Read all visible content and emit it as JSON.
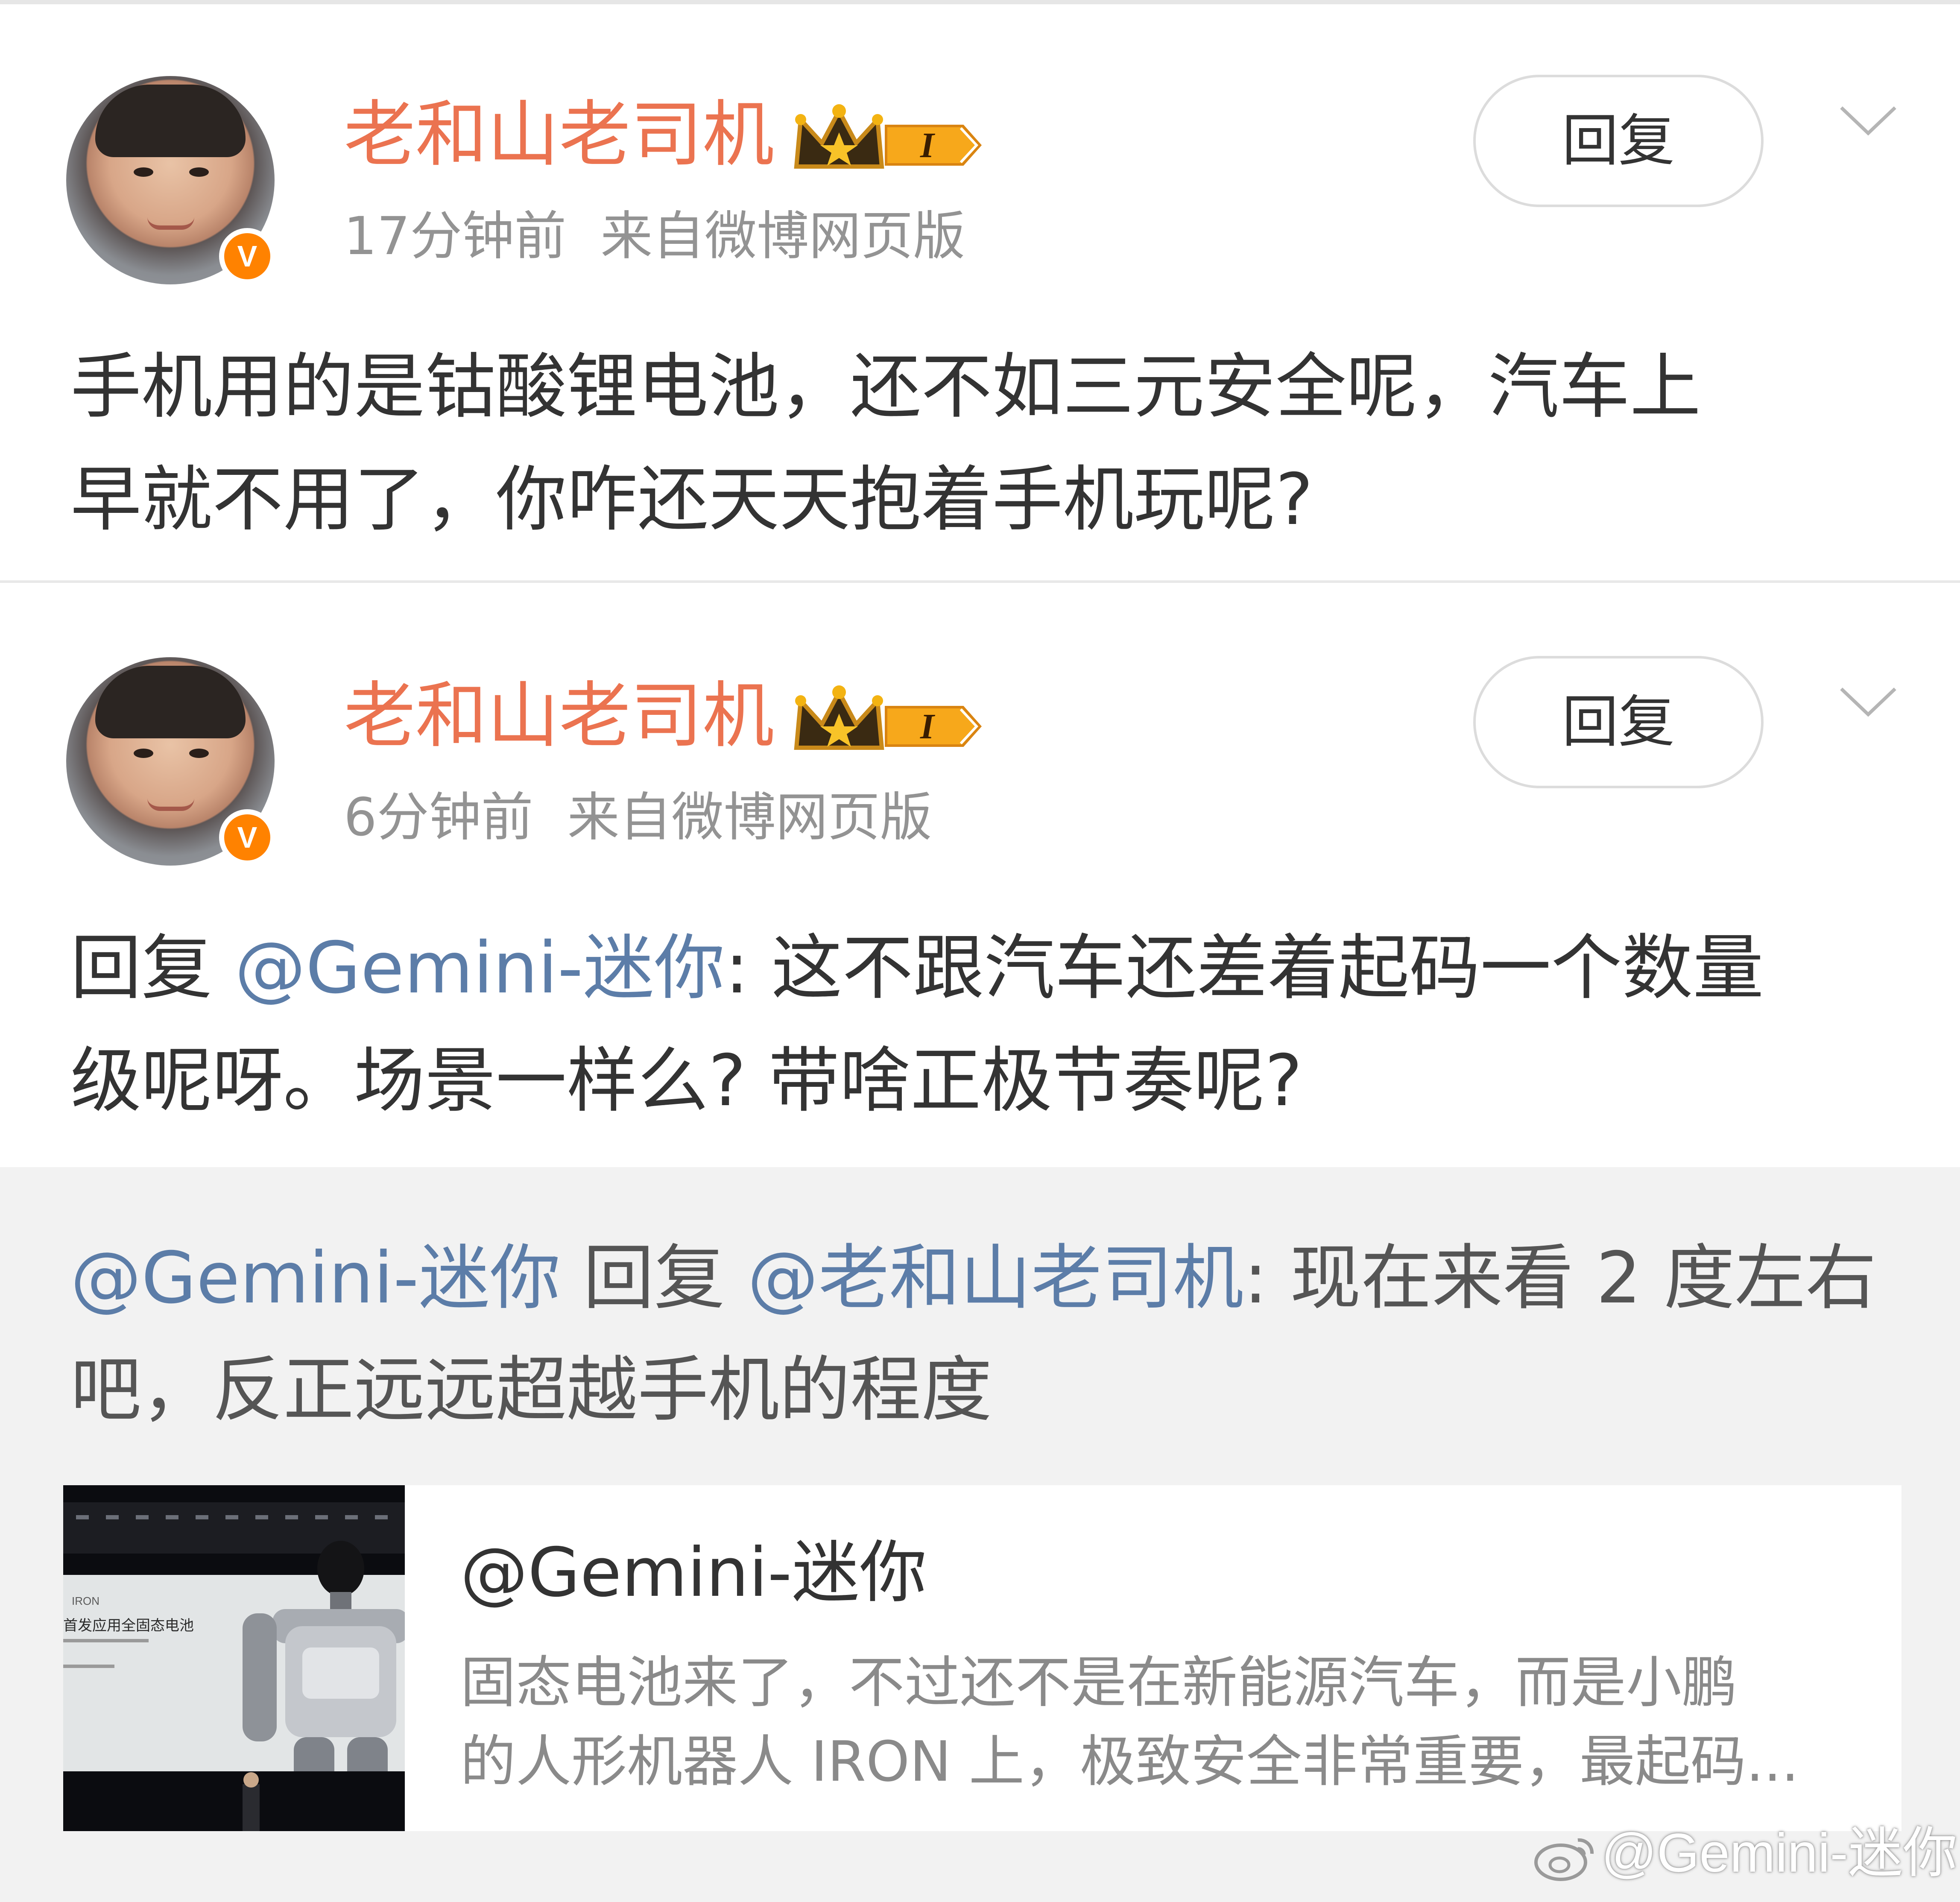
{
  "comments": [
    {
      "username": "老和山老司机",
      "badge_level": "I",
      "verified_mark": "V",
      "time": "17分钟前",
      "source": "来自微博网页版",
      "reply_label": "回复",
      "lines": [
        "手机用的是钴酸锂电池，还不如三元安全呢，汽车上",
        "早就不用了，你咋还天天抱着手机玩呢?"
      ]
    },
    {
      "username": "老和山老司机",
      "badge_level": "I",
      "verified_mark": "V",
      "time": "6分钟前",
      "source": "来自微博网页版",
      "reply_label": "回复",
      "reply_prefix": "回复",
      "reply_mention": "@Gemini-迷你",
      "line1_rest": ": 这不跟汽车还差着起码一个数量",
      "line2": "级呢呀。场景一样么? 带啥正极节奏呢?"
    }
  ],
  "sub_reply": {
    "mention_author": "@Gemini-迷你",
    "reply_word": "回复",
    "mention_target": "@老和山老司机",
    "line1_rest": ": 现在来看 2 度左右",
    "line2": "吧，反正远远超越手机的程度"
  },
  "card": {
    "title": "@Gemini-迷你",
    "desc_line1": "固态电池来了，不过还不是在新能源汽车，而是小鹏",
    "desc_line2": "的人形机器人 IRON 上，极致安全非常重要，最起码...",
    "thumb_text_brand": "IRON",
    "thumb_text_title": "首发应用全固态电池"
  },
  "watermark": "@Gemini-迷你",
  "icons": {
    "verified": "verified-v-icon",
    "crown": "crown-icon",
    "chevron": "chevron-down-icon",
    "weibo": "weibo-logo-icon"
  },
  "colors": {
    "username": "#eb7350",
    "mention": "#5c7da8",
    "verified": "#ff8200",
    "meta": "#939393"
  }
}
